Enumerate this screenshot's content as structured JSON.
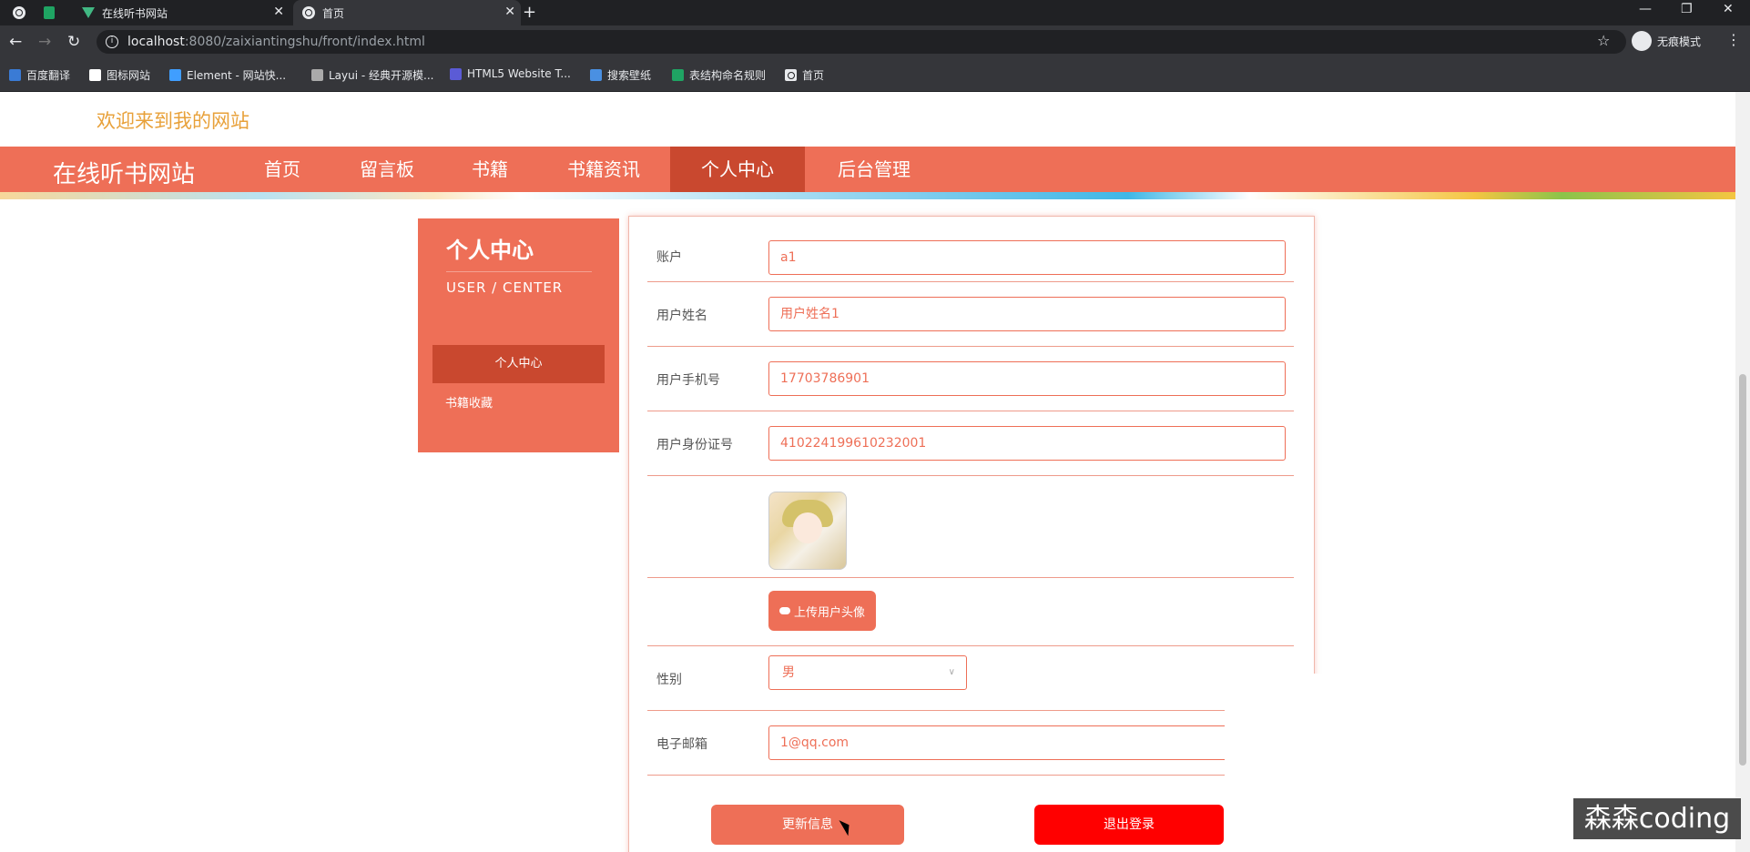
{
  "browser": {
    "tabs": [
      {
        "title": "",
        "icon": "globe-icon"
      },
      {
        "title": "",
        "icon": "sheet-icon"
      },
      {
        "title": "在线听书网站",
        "icon": "vue-icon"
      },
      {
        "title": "首页",
        "icon": "globe-icon"
      }
    ],
    "url_host": "localhost",
    "url_rest": ":8080/zaixiantingshu/front/index.html",
    "incognito_label": "无痕模式",
    "bookmarks": [
      "百度翻译",
      "图标网站",
      "Element - 网站快...",
      "Layui - 经典开源模...",
      "HTML5 Website T...",
      "搜索壁纸",
      "表结构命名规则",
      "首页"
    ]
  },
  "site": {
    "welcome": "欢迎来到我的网站",
    "brand": "在线听书网站",
    "nav": [
      "首页",
      "留言板",
      "书籍",
      "书籍资讯",
      "个人中心",
      "后台管理"
    ],
    "nav_active": "个人中心"
  },
  "sidebar": {
    "title": "个人中心",
    "subtitle": "USER / CENTER",
    "items": [
      "个人中心",
      "书籍收藏"
    ]
  },
  "form": {
    "account": {
      "label": "账户",
      "value": "a1"
    },
    "name": {
      "label": "用户姓名",
      "value": "用户姓名1"
    },
    "phone": {
      "label": "用户手机号",
      "value": "17703786901"
    },
    "idcard": {
      "label": "用户身份证号",
      "value": "410224199610232001"
    },
    "upload_label": "上传用户头像",
    "gender": {
      "label": "性别",
      "value": "男"
    },
    "email": {
      "label": "电子邮箱",
      "value": "1@qq.com"
    },
    "update_button": "更新信息",
    "logout_button": "退出登录"
  },
  "watermark": "森森coding",
  "colors": {
    "primary": "#ee6f57",
    "primary_dark": "#c9482f",
    "danger": "#ff0000",
    "welcome": "#e8a13a"
  }
}
